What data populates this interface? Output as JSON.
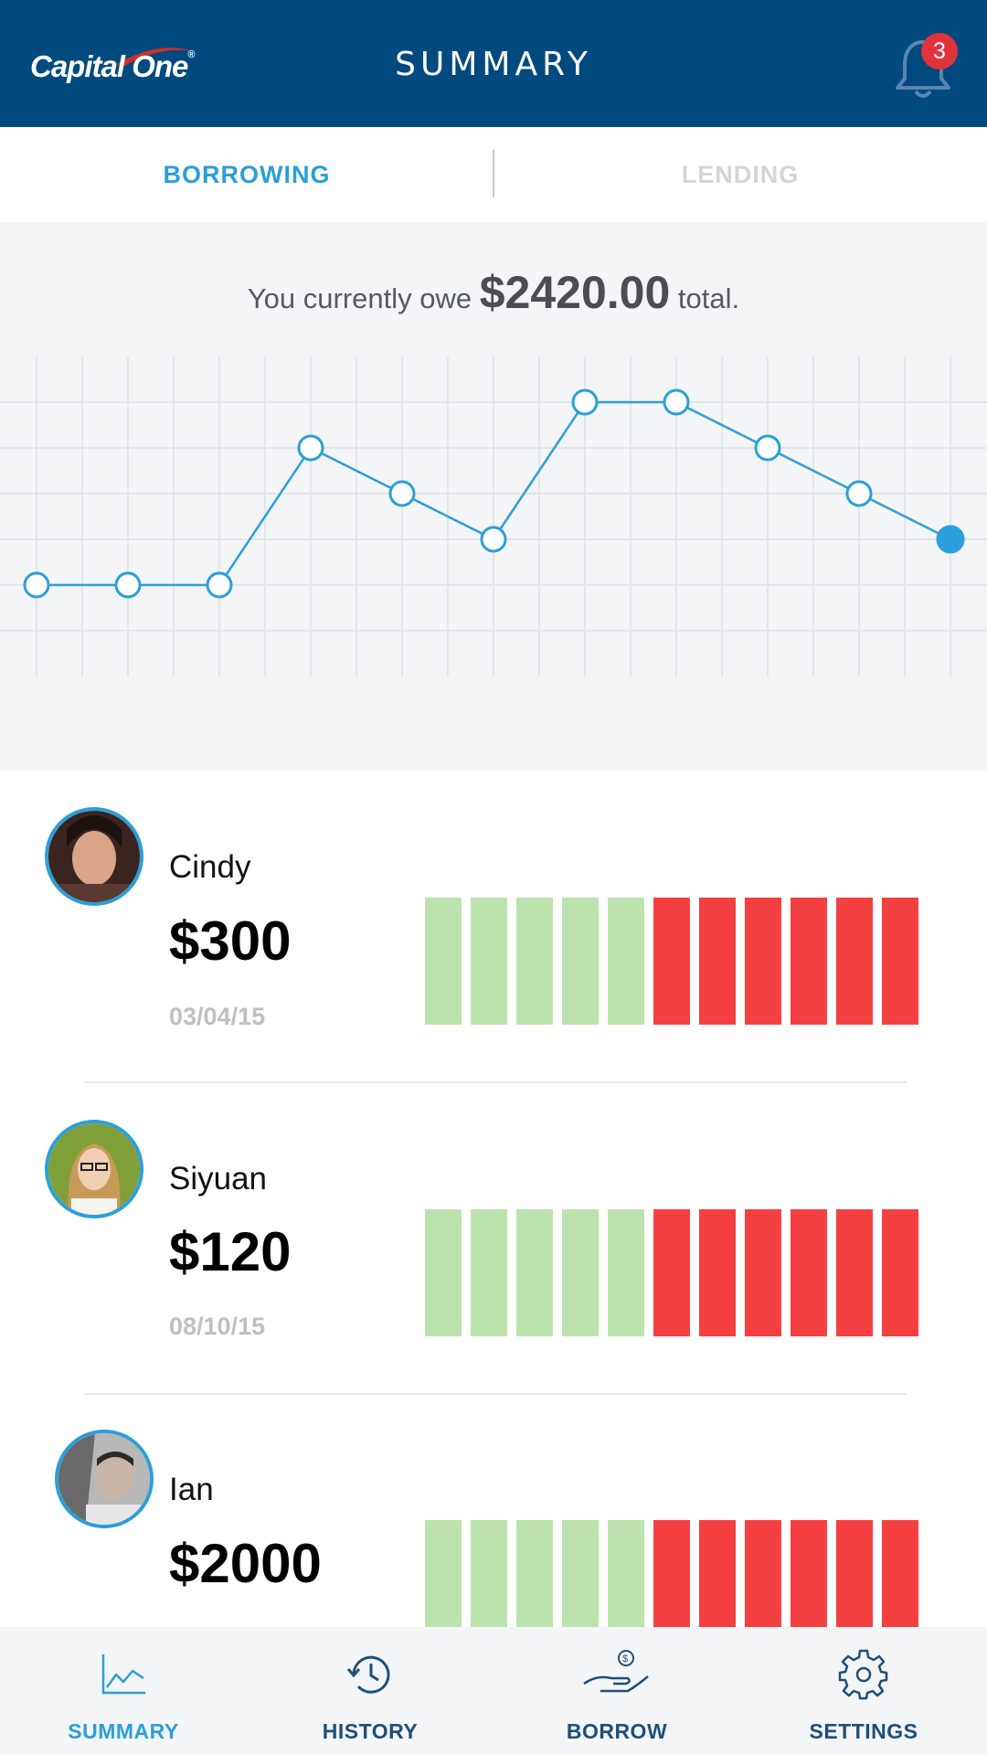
{
  "header": {
    "logo_text": "Capital One",
    "title": "SUMMARY",
    "notification_count": "3"
  },
  "tabs": [
    {
      "label": "BORROWING",
      "active": true
    },
    {
      "label": "LENDING",
      "active": false
    }
  ],
  "summary": {
    "prefix": "You currently owe",
    "amount": "$2420.00",
    "suffix": "total."
  },
  "chart_data": {
    "type": "line",
    "points": [
      1,
      1,
      1,
      4,
      3,
      2,
      5,
      5,
      4,
      3,
      2
    ],
    "last_point_filled": true,
    "grid": true,
    "color": "#2b9fd9"
  },
  "people": [
    {
      "name": "Cindy",
      "amount": "$300",
      "date": "03/04/15",
      "paid_segments": 5,
      "total_segments": 11
    },
    {
      "name": "Siyuan",
      "amount": "$120",
      "date": "08/10/15",
      "paid_segments": 5,
      "total_segments": 11
    },
    {
      "name": "Ian",
      "amount": "$2000",
      "date": "",
      "paid_segments": 5,
      "total_segments": 11
    }
  ],
  "colors": {
    "paid": "#bce3ad",
    "unpaid": "#f54042",
    "accent": "#2b9fd9",
    "header": "#004a80"
  },
  "nav": [
    {
      "label": "SUMMARY",
      "icon": "chart-icon",
      "active": true
    },
    {
      "label": "HISTORY",
      "icon": "history-icon",
      "active": false
    },
    {
      "label": "BORROW",
      "icon": "borrow-icon",
      "active": false
    },
    {
      "label": "SETTINGS",
      "icon": "gear-icon",
      "active": false
    }
  ]
}
